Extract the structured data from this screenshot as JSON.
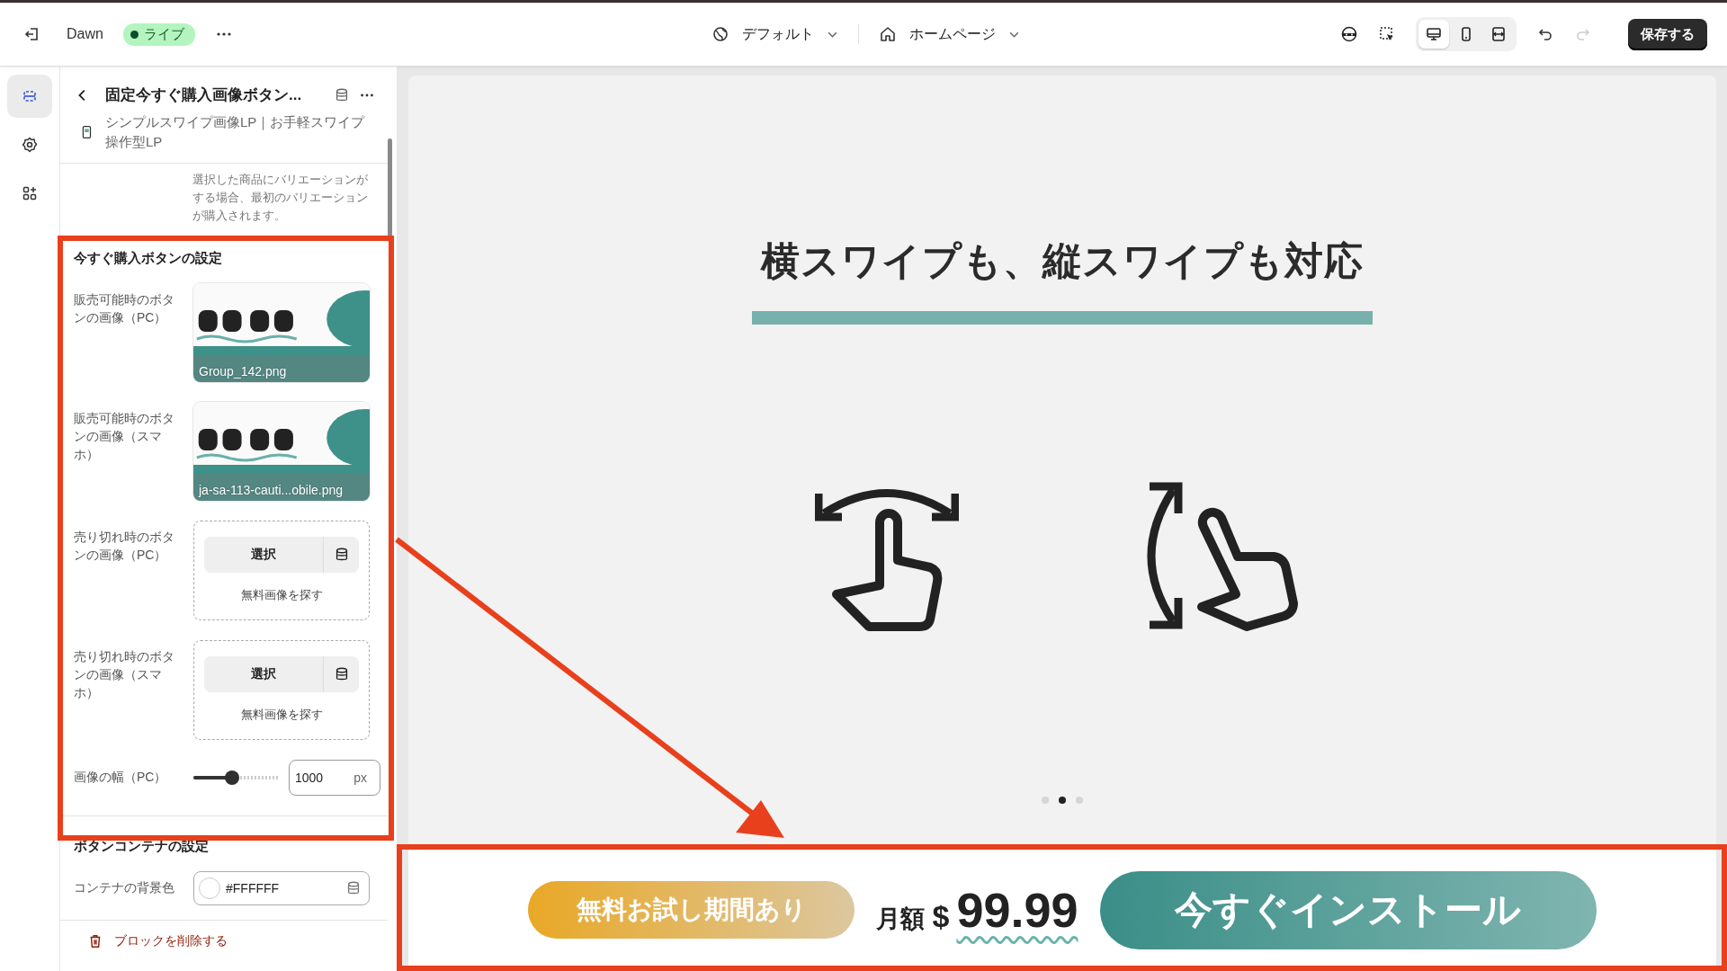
{
  "topbar": {
    "theme_name": "Dawn",
    "status": "ライブ",
    "context": "デフォルト",
    "page": "ホームページ",
    "view_modes": [
      {
        "kind": "desktop",
        "selected": true
      },
      {
        "kind": "mobile",
        "selected": false
      },
      {
        "kind": "fullwidth",
        "selected": false
      }
    ],
    "history": [
      {
        "kind": "undo",
        "disabled": false
      },
      {
        "kind": "redo",
        "disabled": true
      }
    ],
    "save_label": "保存する"
  },
  "rail": [
    {
      "kind": "sections",
      "selected": true
    },
    {
      "kind": "settings",
      "selected": false
    },
    {
      "kind": "apps",
      "selected": false
    }
  ],
  "panel": {
    "title": "固定今すぐ購入画像ボタン...",
    "subtitle": "シンプルスワイプ画像LP｜お手軽スワイプ操作型LP",
    "helper": "選択した商品にバリエーションがする場合、最初のバリエーションが購入されます。",
    "sections": [
      {
        "heading": "今すぐ購入ボタンの設定",
        "fields": [
          {
            "label": "販売可能時のボタンの画像（PC）",
            "filename": "Group_142.png"
          },
          {
            "label": "販売可能時のボタンの画像（スマホ）",
            "filename": "ja-sa-113-cauti...obile.png"
          },
          {
            "kind": "picker",
            "label": "売り切れ時のボタンの画像（PC）",
            "button": "選択",
            "link": "無料画像を探す"
          },
          {
            "kind": "picker",
            "label": "売り切れ時のボタンの画像（スマホ）",
            "button": "選択",
            "link": "無料画像を探す"
          },
          {
            "kind": "range",
            "label": "画像の幅（PC）",
            "level": 0.45,
            "value": "1000",
            "unit": "px"
          }
        ]
      },
      {
        "heading": "ボタンコンテナの設定",
        "fields": [
          {
            "kind": "color",
            "label": "コンテナの背景色",
            "value": "#FFFFFF"
          }
        ]
      }
    ],
    "delete_label": "ブロックを削除する"
  },
  "preview": {
    "heading": "横スワイプも、縦スワイプも対応",
    "dots": [
      {
        "selected": false
      },
      {
        "selected": true
      },
      {
        "selected": false
      }
    ],
    "bar": {
      "badge": "無料お試し期間あり",
      "price_prefix": "月額",
      "currency": "$",
      "price": "99.99",
      "cta": "今すぐインストール"
    }
  }
}
